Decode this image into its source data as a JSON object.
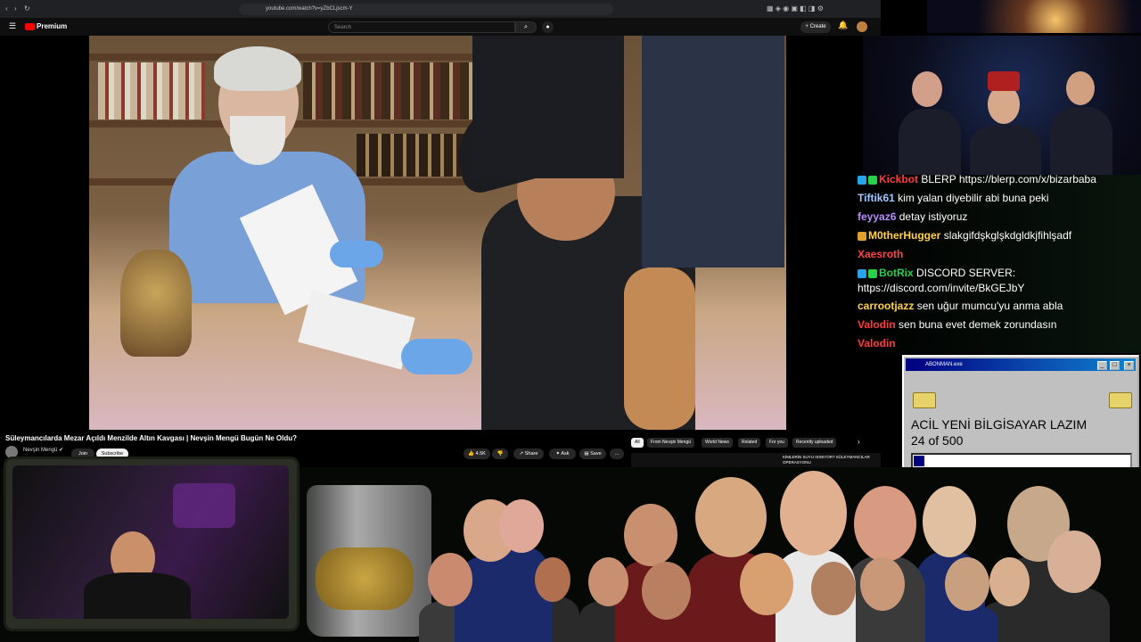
{
  "browser": {
    "url": "youtube.com/watch?v=yZbCLjscm-Y"
  },
  "youtube": {
    "brand": "Premium",
    "search_placeholder": "Search",
    "create_label": "Create",
    "video_title": "Süleymancılarda Mezar Açıldı Menzilde Altın Kavgası | Nevşin Mengü Bugün Ne Oldu?",
    "channel_name": "Nevşin Mengü",
    "join_label": "Join",
    "subscribe_label": "Subscribe",
    "likes": "4.5K",
    "share_label": "Share",
    "ask_label": "Ask",
    "save_label": "Save",
    "more_label": "...",
    "chips": [
      "All",
      "From Nevşin Mengü",
      "World News",
      "Related",
      "For you",
      "Recently uploaded"
    ],
    "next_thumb_text": "KİMLERİN SUYU ISINIYOR? SÜLEYMANCILAR OPERASYONU"
  },
  "chat": {
    "messages": [
      {
        "user": "Kickbot",
        "user_color": "#ff3b3b",
        "text": "BLERP https://blerp.com/x/bizarbaba",
        "badges": [
          "bot",
          "green"
        ]
      },
      {
        "user": "Tiftik61",
        "user_color": "#9ec6ff",
        "text": "kim yalan diyebilir abi buna peki",
        "badges": []
      },
      {
        "user": "feyyaz6",
        "user_color": "#b98cff",
        "text": "detay istiyoruz",
        "badges": []
      },
      {
        "user": "M0therHugger",
        "user_color": "#ffd24a",
        "text": "slakgifdşkglşkdgldkjfihlşadf",
        "badges": [
          "emoji"
        ]
      },
      {
        "user": "Xaesroth",
        "user_color": "#ff4444",
        "text": "",
        "badges": []
      },
      {
        "user": "BotRix",
        "user_color": "#27d14a",
        "text": "DISCORD SERVER:",
        "badges": [
          "bot",
          "green"
        ]
      },
      {
        "user": "",
        "user_color": "#ffffff",
        "text": "https://discord.com/invite/BkGEJbY",
        "badges": []
      },
      {
        "user": "carrootjazz",
        "user_color": "#ffd24a",
        "text": "sen uğur mumcu'yu anma abla",
        "badges": []
      },
      {
        "user": "Valodin",
        "user_color": "#ff3b3b",
        "text": "sen buna evet demek zorundasın",
        "badges": []
      },
      {
        "user": "Valodin",
        "user_color": "#ff3b3b",
        "text": "",
        "badges": []
      }
    ]
  },
  "goal_window": {
    "title": "ABONMAN.exe",
    "goal_text": "ACİL YENİ BİLGİSAYAR LAZIM",
    "count_text": "24 of 500",
    "progress": 0.048
  },
  "colors": {
    "youtube_red": "#ff0000",
    "win_title_start": "#000080",
    "win_title_end": "#1084d0",
    "goal_fill": "#000080"
  },
  "icons": [
    "menu-icon",
    "search-icon",
    "mic-icon",
    "bell-icon",
    "like-icon",
    "dislike-icon",
    "share-icon",
    "sparkle-icon",
    "save-icon",
    "chevron-right-icon",
    "folder-icon",
    "minimize-icon",
    "maximize-icon",
    "close-icon"
  ]
}
